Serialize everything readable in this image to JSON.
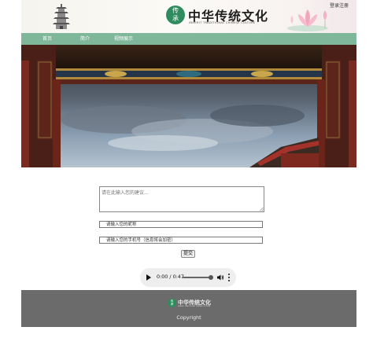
{
  "header": {
    "logo_char_top": "传",
    "logo_char_bottom": "承",
    "title": "中华传统文化",
    "subtitle": "INHERIT TRADITIONAL CHINESE CULTURE",
    "login": "登录注册"
  },
  "nav": {
    "items": [
      {
        "label": "首页"
      },
      {
        "label": "简介"
      },
      {
        "label": "视频展示"
      }
    ]
  },
  "form": {
    "suggestion_placeholder": "请在此输入您的建议...",
    "nickname_placeholder": "请输入您的昵称",
    "phone_placeholder": "请输入您的手机号（信息将会加密）",
    "submit_label": "提交"
  },
  "audio": {
    "time": "0:00 / 0:47",
    "progress": 0
  },
  "footer": {
    "logo_char_top": "传",
    "logo_char_bottom": "承",
    "title": "中华传统文化",
    "subtitle": "INHERIT TRADITIONAL CHINESE CULTURE",
    "copyright": "Copyright"
  },
  "colors": {
    "nav": "#7fb79a",
    "brand": "#2f8c5e",
    "footer": "#6b6b6b"
  }
}
